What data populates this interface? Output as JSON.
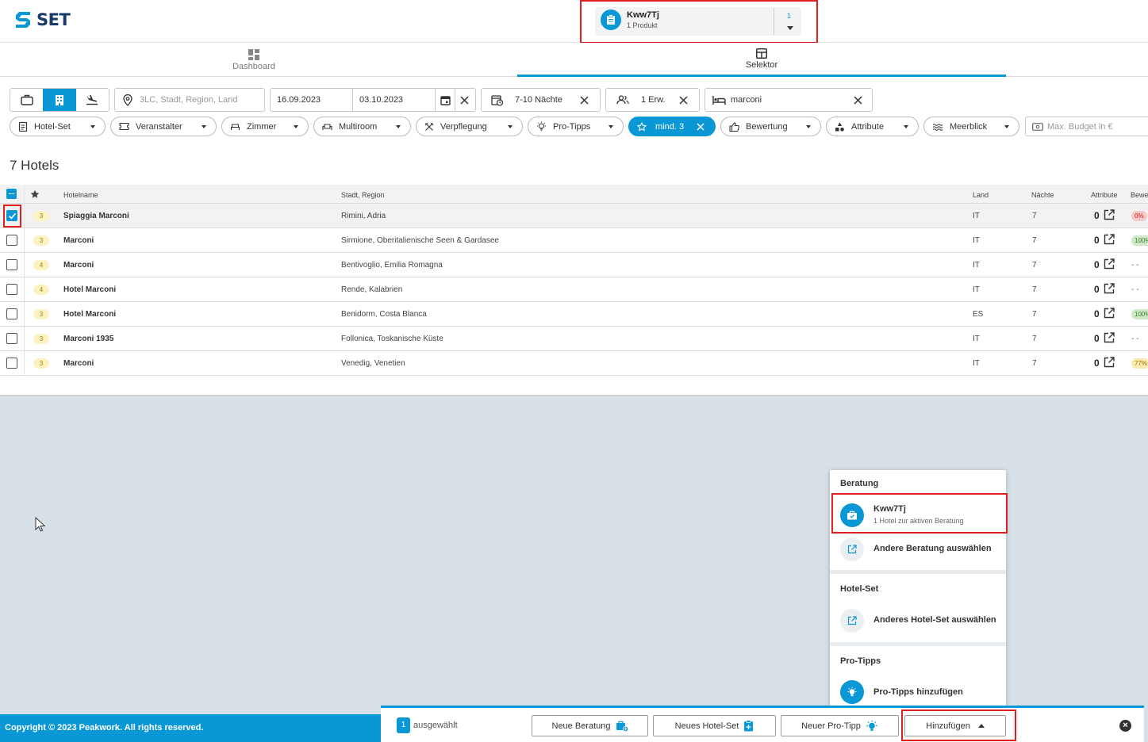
{
  "app": {
    "logo": "SET"
  },
  "consultation": {
    "name": "Kww7Tj",
    "sub": "1 Produkt",
    "count": "1"
  },
  "tabs": [
    {
      "label": "Dashboard"
    },
    {
      "label": "Selektor"
    }
  ],
  "search": {
    "location_placeholder": "3LC, Stadt, Region, Land",
    "date_from": "16.09.2023",
    "date_to": "03.10.2023",
    "nights": "7-10 Nächte",
    "travellers": "1 Erw.",
    "hotel_query": "marconi",
    "budget_placeholder": "Max. Budget in €"
  },
  "filters": {
    "hotel_set": "Hotel-Set",
    "veranstalter": "Veranstalter",
    "zimmer": "Zimmer",
    "multiroom": "Multiroom",
    "verpflegung": "Verpflegung",
    "pro_tipps": "Pro-Tipps",
    "stars": "mind. 3",
    "bewertung": "Bewertung",
    "attribute": "Attribute",
    "meerblick": "Meerblick"
  },
  "results": {
    "count_label": "7 Hotels"
  },
  "table": {
    "headers": {
      "name": "Hotelname",
      "city": "Stadt, Region",
      "country": "Land",
      "nights": "Nächte",
      "attributes": "Attribute",
      "rating": "Bewe"
    },
    "rows": [
      {
        "stars": "3",
        "name": "Spiaggia Marconi",
        "city": "Rimini, Adria",
        "country": "IT",
        "nights": "7",
        "attr": "0",
        "rating": "0%",
        "rating_color": "red",
        "selected": true
      },
      {
        "stars": "3",
        "name": "Marconi",
        "city": "Sirmione, Oberitalienische Seen & Gardasee",
        "country": "IT",
        "nights": "7",
        "attr": "0",
        "rating": "100%",
        "rating_color": "green",
        "selected": false
      },
      {
        "stars": "4",
        "name": "Marconi",
        "city": "Bentivoglio, Emilia Romagna",
        "country": "IT",
        "nights": "7",
        "attr": "0",
        "rating": "- -",
        "rating_color": "none",
        "selected": false
      },
      {
        "stars": "4",
        "name": "Hotel Marconi",
        "city": "Rende, Kalabrien",
        "country": "IT",
        "nights": "7",
        "attr": "0",
        "rating": "- -",
        "rating_color": "none",
        "selected": false
      },
      {
        "stars": "3",
        "name": "Hotel Marconi",
        "city": "Benidorm, Costa Blanca",
        "country": "ES",
        "nights": "7",
        "attr": "0",
        "rating": "100%",
        "rating_color": "green",
        "selected": false
      },
      {
        "stars": "3",
        "name": "Marconi 1935",
        "city": "Follonica, Toskanische Küste",
        "country": "IT",
        "nights": "7",
        "attr": "0",
        "rating": "- -",
        "rating_color": "none",
        "selected": false
      },
      {
        "stars": "3",
        "name": "Marconi",
        "city": "Venedig, Venetien",
        "country": "IT",
        "nights": "7",
        "attr": "0",
        "rating": "77%",
        "rating_color": "yellow",
        "selected": false
      }
    ]
  },
  "menu": {
    "section_beratung": "Beratung",
    "beratung_item": "Kww7Tj",
    "beratung_item_sub": "1 Hotel zur aktiven Beratung",
    "other_beratung": "Andere Beratung auswählen",
    "section_hotelset": "Hotel-Set",
    "other_hotelset": "Anderes Hotel-Set auswählen",
    "section_protipps": "Pro-Tipps",
    "add_protipps": "Pro-Tipps hinzufügen"
  },
  "footer": {
    "copyright": "Copyright © 2023 Peakwork. All rights reserved.",
    "selected_count": "1",
    "selected_label": "ausgewählt",
    "new_beratung": "Neue Beratung",
    "new_hotelset": "Neues Hotel-Set",
    "new_protipp": "Neuer Pro-Tipp",
    "add": "Hinzufügen"
  },
  "colors": {
    "accent": "#0a97d6",
    "highlight": "#e02020",
    "logo": "#1a3a6b"
  }
}
